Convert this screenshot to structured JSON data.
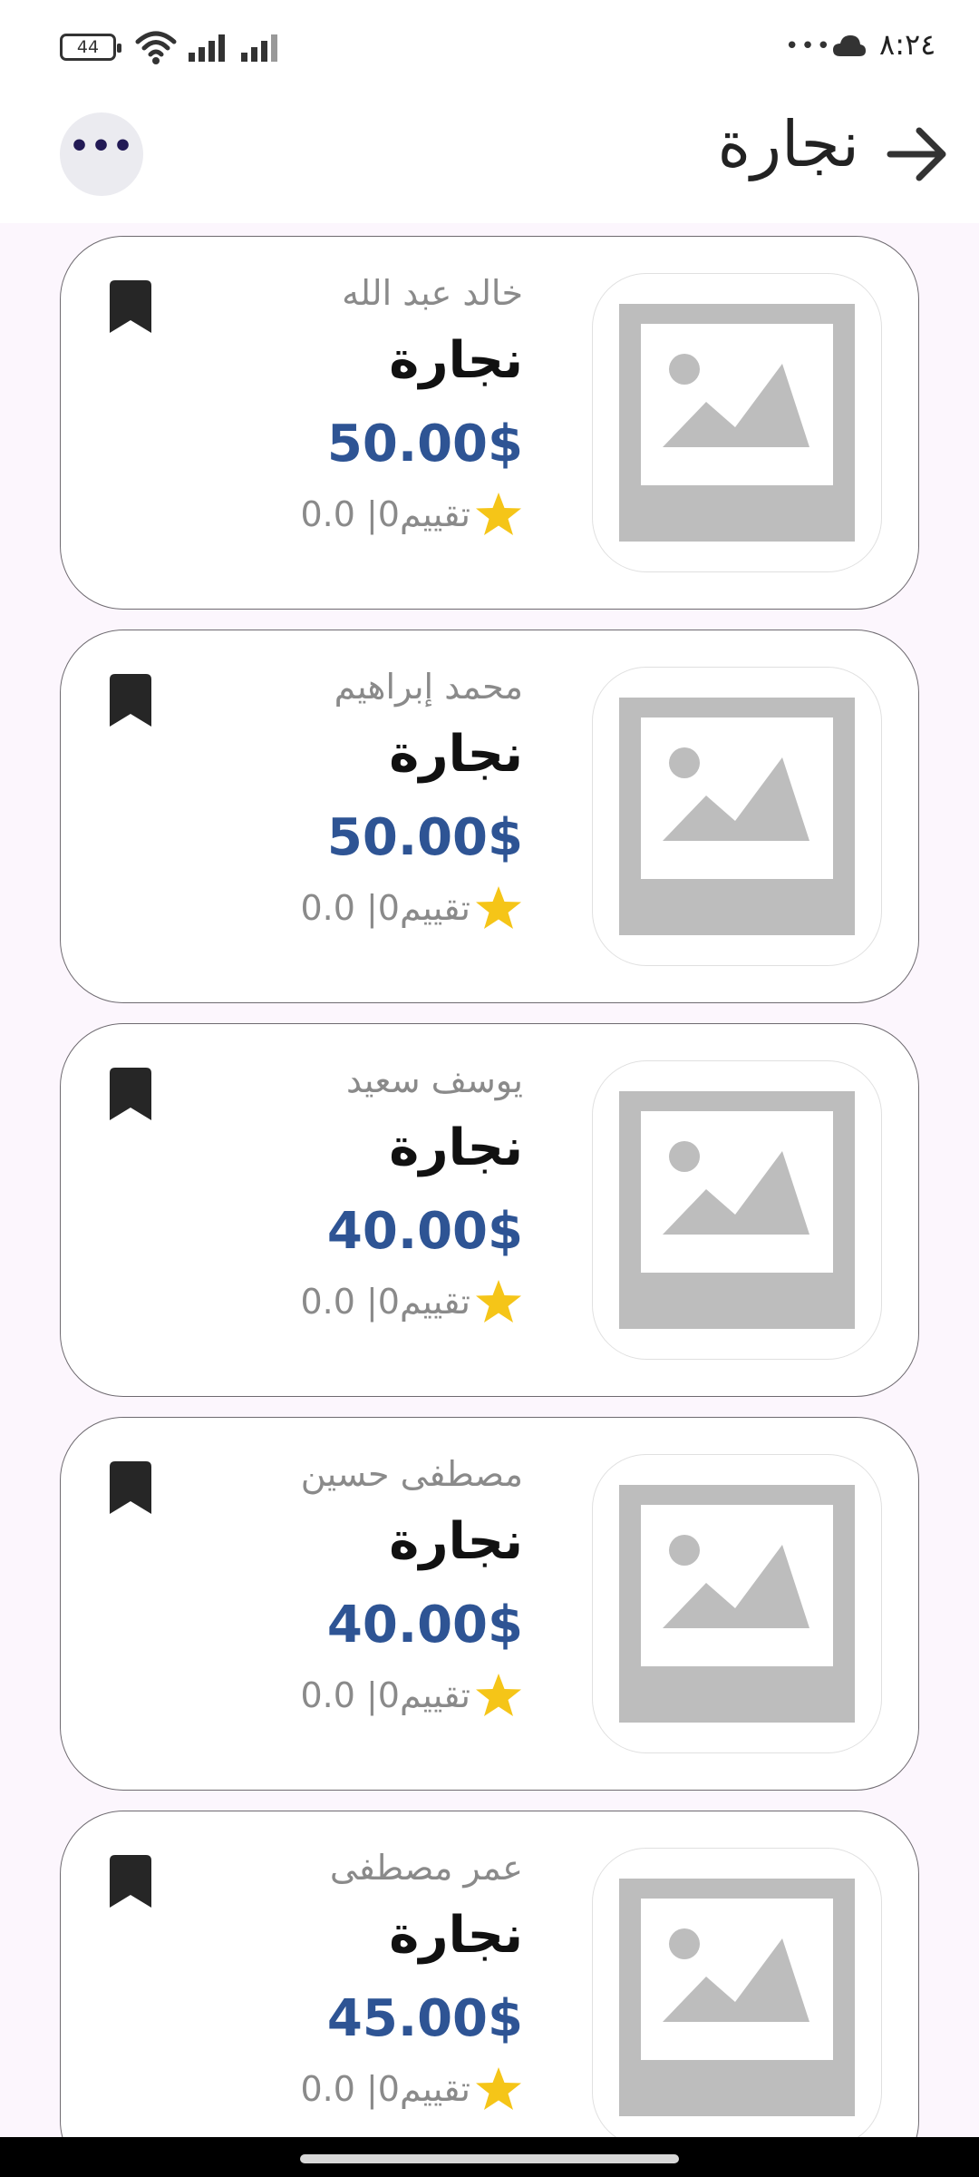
{
  "status_bar": {
    "time": "٨:٢٤",
    "battery": "44",
    "dots": "•••"
  },
  "header": {
    "title": "نجارة",
    "more_label": "•••"
  },
  "products": [
    {
      "seller": "خالد عبد الله",
      "title": "نجارة",
      "price": "50.00$",
      "rating": "0.0 |0تقييم"
    },
    {
      "seller": "محمد إبراهيم",
      "title": "نجارة",
      "price": "50.00$",
      "rating": "0.0 |0تقييم"
    },
    {
      "seller": "يوسف سعيد",
      "title": "نجارة",
      "price": "40.00$",
      "rating": "0.0 |0تقييم"
    },
    {
      "seller": "مصطفى حسين",
      "title": "نجارة",
      "price": "40.00$",
      "rating": "0.0 |0تقييم"
    },
    {
      "seller": "عمر مصطفى",
      "title": "نجارة",
      "price": "45.00$",
      "rating": "0.0 |0تقييم"
    }
  ],
  "colors": {
    "accent_price": "#2e5494",
    "star": "#f5c518",
    "background": "#fcf6fd"
  }
}
